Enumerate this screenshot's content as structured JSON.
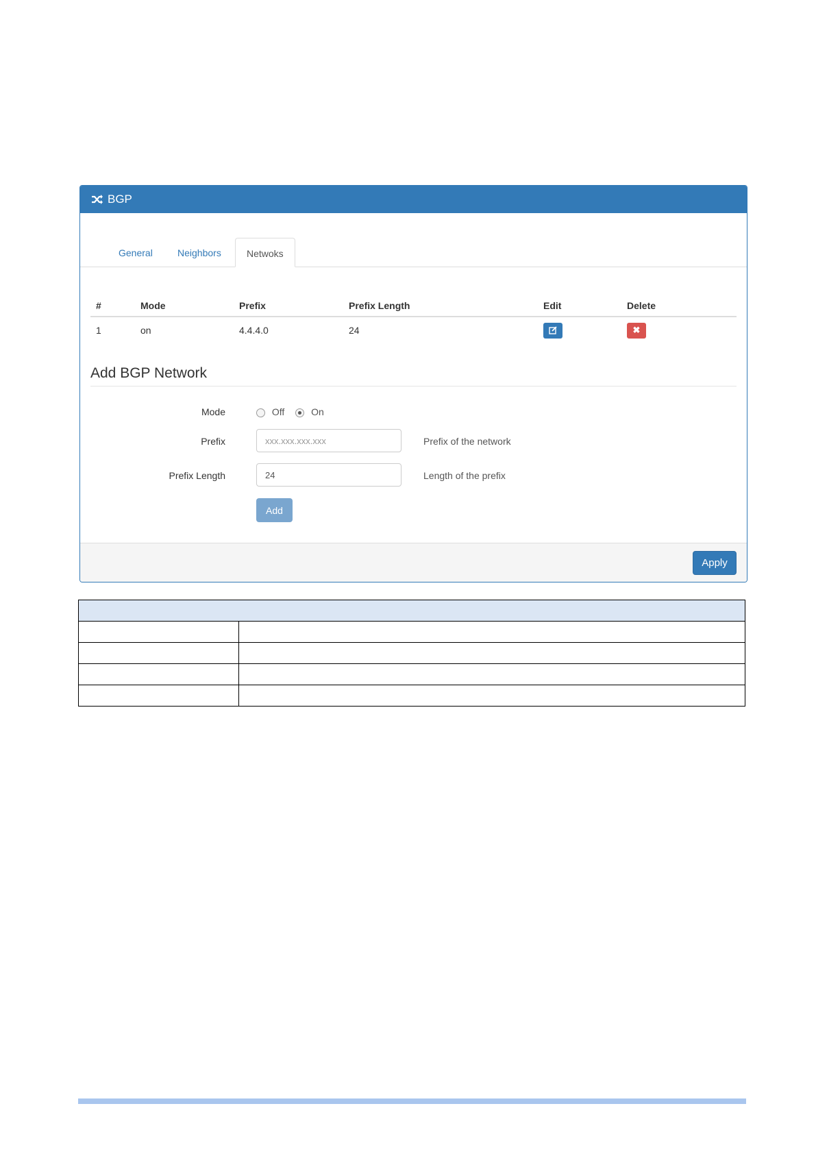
{
  "panel": {
    "title": "BGP",
    "icon": "random-icon",
    "heading_color": "#337ab7"
  },
  "tabs": [
    {
      "label": "General",
      "active": false
    },
    {
      "label": "Neighbors",
      "active": false
    },
    {
      "label": "Netwoks",
      "active": true
    }
  ],
  "networks_table": {
    "headers": [
      "#",
      "Mode",
      "Prefix",
      "Prefix Length",
      "Edit",
      "Delete"
    ],
    "rows": [
      {
        "index": "1",
        "mode": "on",
        "prefix": "4.4.4.0",
        "prefix_length": "24"
      }
    ]
  },
  "add_section": {
    "title": "Add BGP Network",
    "mode_label": "Mode",
    "mode_options": [
      {
        "label": "Off",
        "checked": false
      },
      {
        "label": "On",
        "checked": true
      }
    ],
    "prefix_label": "Prefix",
    "prefix_placeholder": "xxx.xxx.xxx.xxx",
    "prefix_value": "",
    "prefix_help": "Prefix of the network",
    "prefix_length_label": "Prefix Length",
    "prefix_length_value": "24",
    "prefix_length_help": "Length of the prefix",
    "add_label": "Add"
  },
  "footer": {
    "apply_label": "Apply"
  },
  "colors": {
    "primary": "#337ab7",
    "danger": "#d9534f",
    "doc_table_header": "#dbe6f4",
    "bottom_bar": "#a9c6ee"
  }
}
